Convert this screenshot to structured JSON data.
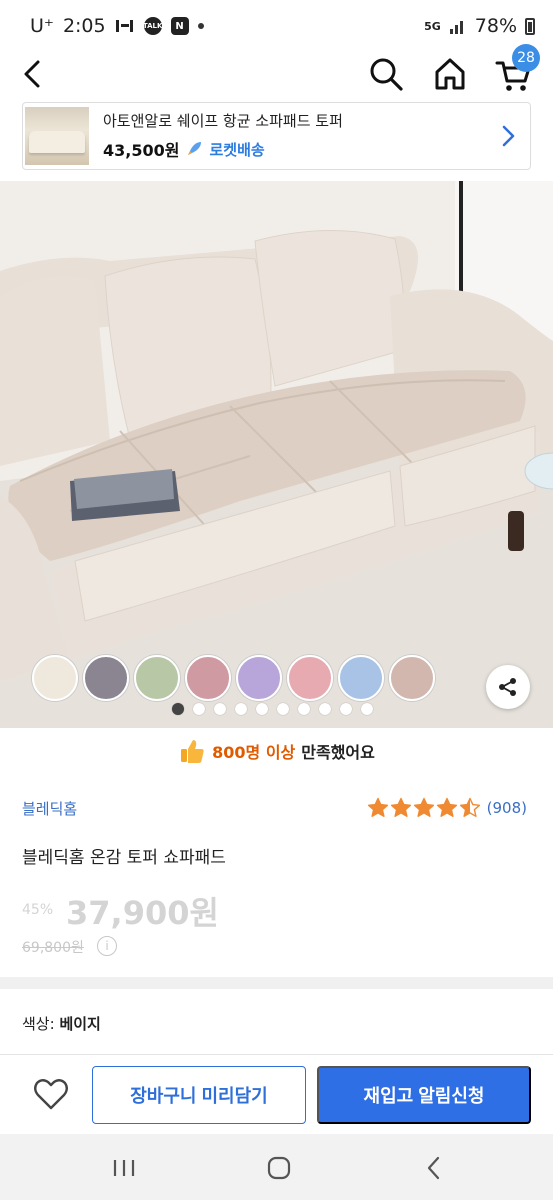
{
  "status_bar": {
    "carrier": "U⁺",
    "time": "2:05",
    "icons_left": [
      "talk-icon",
      "naver-icon"
    ],
    "network": "5G",
    "battery": "78%"
  },
  "nav": {
    "icons": [
      "back-icon",
      "search-icon",
      "home-icon",
      "cart-icon"
    ],
    "cart_count": "28"
  },
  "mini_banner": {
    "title": "아토앤알로 쉐이프 항균 소파패드 토퍼",
    "price": "43,500원",
    "delivery": "로켓배송"
  },
  "hero": {
    "swatch_colors": [
      "#efe8dd",
      "#8a8590",
      "#b8c7a6",
      "#cf9aa1",
      "#b8a6db",
      "#e8aab1",
      "#a9c3e6",
      "#d2b7ae"
    ],
    "page_count": 10,
    "active_page": 0
  },
  "satisfaction": {
    "highlight": "800명 이상",
    "suffix": "만족했어요"
  },
  "product": {
    "brand": "블레딕홈",
    "rating": 4.5,
    "review_count": "(908)",
    "title": "블레딕홈 온감 토퍼 쇼파패드",
    "discount": "45%",
    "price": "37,900원",
    "original_price": "69,800원"
  },
  "option": {
    "label": "색상:",
    "value": "베이지"
  },
  "actions": {
    "wishlist_icon": "heart-icon",
    "add_to_cart": "장바구니 미리담기",
    "restock_alert": "재입고 알림신청"
  },
  "colors": {
    "accent_blue": "#2f6fe6",
    "link_blue": "#3a6fc4",
    "star_orange": "#f08a32",
    "highlight_orange": "#e05b00"
  }
}
